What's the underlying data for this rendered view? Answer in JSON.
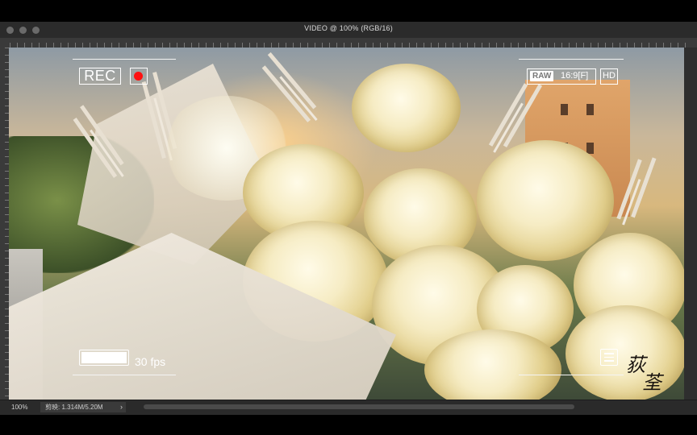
{
  "window": {
    "title": "VIDEO @ 100% (RGB/16)"
  },
  "camera_overlay": {
    "rec_label": "REC",
    "raw_label": "RAW",
    "aspect_label": "16:9[F]",
    "hd_label": "HD",
    "fps_label": "30 fps",
    "battery_level_percent": 100,
    "record_dot_color": "#ff1010"
  },
  "watermark": {
    "line1": "荻",
    "line2": "荃"
  },
  "status": {
    "zoom": "100%",
    "doc_info": "剪映: 1.314M/5.20M",
    "expand_glyph": "›"
  },
  "icons": [
    "record-dot-icon",
    "menu-list-icon",
    "chevron-right-icon",
    "battery-icon"
  ]
}
